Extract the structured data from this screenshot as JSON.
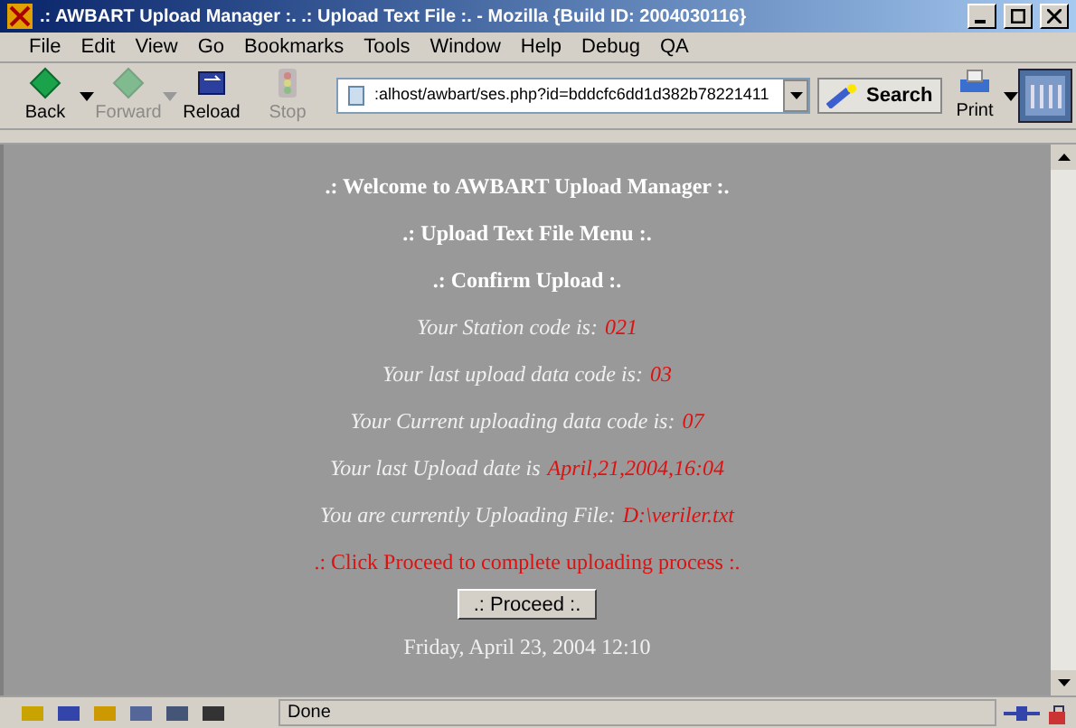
{
  "window": {
    "title": ".: AWBART Upload Manager :. .: Upload Text File :. - Mozilla {Build ID: 2004030116}"
  },
  "menu": [
    "File",
    "Edit",
    "View",
    "Go",
    "Bookmarks",
    "Tools",
    "Window",
    "Help",
    "Debug",
    "QA"
  ],
  "toolbar": [
    {
      "label": "Back",
      "disabled": false,
      "kind": "back",
      "dropdown": true
    },
    {
      "label": "Forward",
      "disabled": true,
      "kind": "forward",
      "dropdown": true
    },
    {
      "label": "Reload",
      "disabled": false,
      "kind": "reload",
      "dropdown": false
    },
    {
      "label": "Stop",
      "disabled": true,
      "kind": "stop",
      "dropdown": false
    }
  ],
  "address": {
    "value": ":alhost/awbart/ses.php?id=bddcfc6dd1d382b78221411"
  },
  "search_button": "Search",
  "print_button": "Print",
  "content": {
    "headings": [
      ".: Welcome to AWBART Upload Manager :.",
      ".: Upload Text File Menu :.",
      ".: Confirm Upload :."
    ],
    "info": [
      {
        "label": "Your Station code is:",
        "value": "021"
      },
      {
        "label": "Your last upload data code is:",
        "value": "03"
      },
      {
        "label": "Your Current uploading data code is:",
        "value": "07"
      },
      {
        "label": "Your last Upload date is",
        "value": "April,21,2004,16:04"
      },
      {
        "label": "You are currently Uploading File:",
        "value": "D:\\veriler.txt"
      }
    ],
    "notice": ".: Click Proceed to complete uploading process :.",
    "button": ".: Proceed :.",
    "date": "Friday, April 23, 2004 12:10"
  },
  "status_bar": {
    "text": "Done"
  }
}
